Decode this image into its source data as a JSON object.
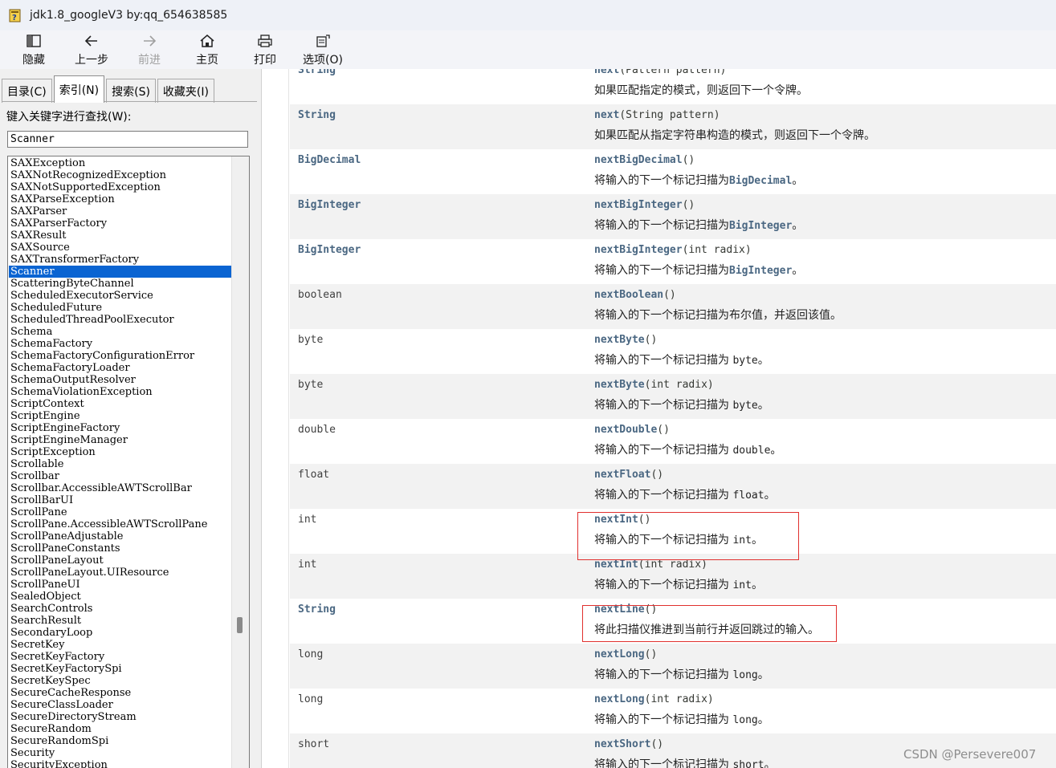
{
  "window": {
    "title": "jdk1.8_googleV3 by:qq_654638585"
  },
  "toolbar": {
    "items": [
      {
        "label": "隐藏",
        "icon": "hide-pane-icon",
        "enabled": true
      },
      {
        "label": "上一步",
        "icon": "back-arrow-icon",
        "enabled": true
      },
      {
        "label": "前进",
        "icon": "forward-arrow-icon",
        "enabled": false
      },
      {
        "label": "主页",
        "icon": "home-icon",
        "enabled": true
      },
      {
        "label": "打印",
        "icon": "printer-icon",
        "enabled": true
      },
      {
        "label": "选项(O)",
        "icon": "options-icon",
        "enabled": true
      }
    ]
  },
  "nav": {
    "tabs": [
      {
        "label": "目录(C)",
        "active": false
      },
      {
        "label": "索引(N)",
        "active": true
      },
      {
        "label": "搜索(S)",
        "active": false
      },
      {
        "label": "收藏夹(I)",
        "active": false
      }
    ],
    "keyword_label": "键入关键字进行查找(W):",
    "search_value": "Scanner",
    "selected": "Scanner",
    "items": [
      "SAXException",
      "SAXNotRecognizedException",
      "SAXNotSupportedException",
      "SAXParseException",
      "SAXParser",
      "SAXParserFactory",
      "SAXResult",
      "SAXSource",
      "SAXTransformerFactory",
      "Scanner",
      "ScatteringByteChannel",
      "ScheduledExecutorService",
      "ScheduledFuture",
      "ScheduledThreadPoolExecutor",
      "Schema",
      "SchemaFactory",
      "SchemaFactoryConfigurationError",
      "SchemaFactoryLoader",
      "SchemaOutputResolver",
      "SchemaViolationException",
      "ScriptContext",
      "ScriptEngine",
      "ScriptEngineFactory",
      "ScriptEngineManager",
      "ScriptException",
      "Scrollable",
      "Scrollbar",
      "Scrollbar.AccessibleAWTScrollBar",
      "ScrollBarUI",
      "ScrollPane",
      "ScrollPane.AccessibleAWTScrollPane",
      "ScrollPaneAdjustable",
      "ScrollPaneConstants",
      "ScrollPaneLayout",
      "ScrollPaneLayout.UIResource",
      "ScrollPaneUI",
      "SealedObject",
      "SearchControls",
      "SearchResult",
      "SecondaryLoop",
      "SecretKey",
      "SecretKeyFactory",
      "SecretKeyFactorySpi",
      "SecretKeySpec",
      "SecureCacheResponse",
      "SecureClassLoader",
      "SecureDirectoryStream",
      "SecureRandom",
      "SecureRandomSpi",
      "Security",
      "SecurityException"
    ]
  },
  "methods": [
    {
      "type": "String",
      "type_link": true,
      "name": "next",
      "params": "(Pattern pattern)",
      "desc": [
        {
          "t": "如果匹配指定的模式，则返回下一个令牌。"
        }
      ]
    },
    {
      "type": "String",
      "type_link": true,
      "name": "next",
      "params": "(String pattern)",
      "desc": [
        {
          "t": "如果匹配从指定字符串构造的模式，则返回下一个令牌。"
        }
      ]
    },
    {
      "type": "BigDecimal",
      "type_link": true,
      "name": "nextBigDecimal",
      "params": "()",
      "desc": [
        {
          "t": "将输入的下一个标记扫描为"
        },
        {
          "c": "BigDecimal",
          "link": true
        },
        {
          "t": "。"
        }
      ]
    },
    {
      "type": "BigInteger",
      "type_link": true,
      "name": "nextBigInteger",
      "params": "()",
      "desc": [
        {
          "t": "将输入的下一个标记扫描为"
        },
        {
          "c": "BigInteger",
          "link": true
        },
        {
          "t": "。"
        }
      ]
    },
    {
      "type": "BigInteger",
      "type_link": true,
      "name": "nextBigInteger",
      "params": "(int radix)",
      "desc": [
        {
          "t": "将输入的下一个标记扫描为"
        },
        {
          "c": "BigInteger",
          "link": true
        },
        {
          "t": "。"
        }
      ]
    },
    {
      "type": "boolean",
      "type_link": false,
      "name": "nextBoolean",
      "params": "()",
      "desc": [
        {
          "t": "将输入的下一个标记扫描为布尔值，并返回该值。"
        }
      ]
    },
    {
      "type": "byte",
      "type_link": false,
      "name": "nextByte",
      "params": "()",
      "desc": [
        {
          "t": "将输入的下一个标记扫描为 "
        },
        {
          "c": "byte"
        },
        {
          "t": "。"
        }
      ]
    },
    {
      "type": "byte",
      "type_link": false,
      "name": "nextByte",
      "params": "(int radix)",
      "desc": [
        {
          "t": "将输入的下一个标记扫描为 "
        },
        {
          "c": "byte"
        },
        {
          "t": "。"
        }
      ]
    },
    {
      "type": "double",
      "type_link": false,
      "name": "nextDouble",
      "params": "()",
      "desc": [
        {
          "t": "将输入的下一个标记扫描为 "
        },
        {
          "c": "double"
        },
        {
          "t": "。"
        }
      ]
    },
    {
      "type": "float",
      "type_link": false,
      "name": "nextFloat",
      "params": "()",
      "desc": [
        {
          "t": "将输入的下一个标记扫描为 "
        },
        {
          "c": "float"
        },
        {
          "t": "。"
        }
      ]
    },
    {
      "type": "int",
      "type_link": false,
      "name": "nextInt",
      "params": "()",
      "desc": [
        {
          "t": "将输入的下一个标记扫描为 "
        },
        {
          "c": "int"
        },
        {
          "t": "。"
        }
      ],
      "highlight": true
    },
    {
      "type": "int",
      "type_link": false,
      "name": "nextInt",
      "params": "(int radix)",
      "desc": [
        {
          "t": "将输入的下一个标记扫描为 "
        },
        {
          "c": "int"
        },
        {
          "t": "。"
        }
      ]
    },
    {
      "type": "String",
      "type_link": true,
      "name": "nextLine",
      "params": "()",
      "desc": [
        {
          "t": "将此扫描仪推进到当前行并返回跳过的输入。"
        }
      ],
      "highlight": true
    },
    {
      "type": "long",
      "type_link": false,
      "name": "nextLong",
      "params": "()",
      "desc": [
        {
          "t": "将输入的下一个标记扫描为 "
        },
        {
          "c": "long"
        },
        {
          "t": "。"
        }
      ]
    },
    {
      "type": "long",
      "type_link": false,
      "name": "nextLong",
      "params": "(int radix)",
      "desc": [
        {
          "t": "将输入的下一个标记扫描为 "
        },
        {
          "c": "long"
        },
        {
          "t": "。"
        }
      ]
    },
    {
      "type": "short",
      "type_link": false,
      "name": "nextShort",
      "params": "()",
      "desc": [
        {
          "t": "将输入的下一个标记扫描为 "
        },
        {
          "c": "short"
        },
        {
          "t": "。"
        }
      ]
    }
  ],
  "watermark": "CSDN @Persevere007",
  "colors": {
    "selection": "#0a64d2",
    "link": "#4a6782",
    "highlight_box": "#e0302e",
    "row_alt": "#f2f2f2"
  }
}
